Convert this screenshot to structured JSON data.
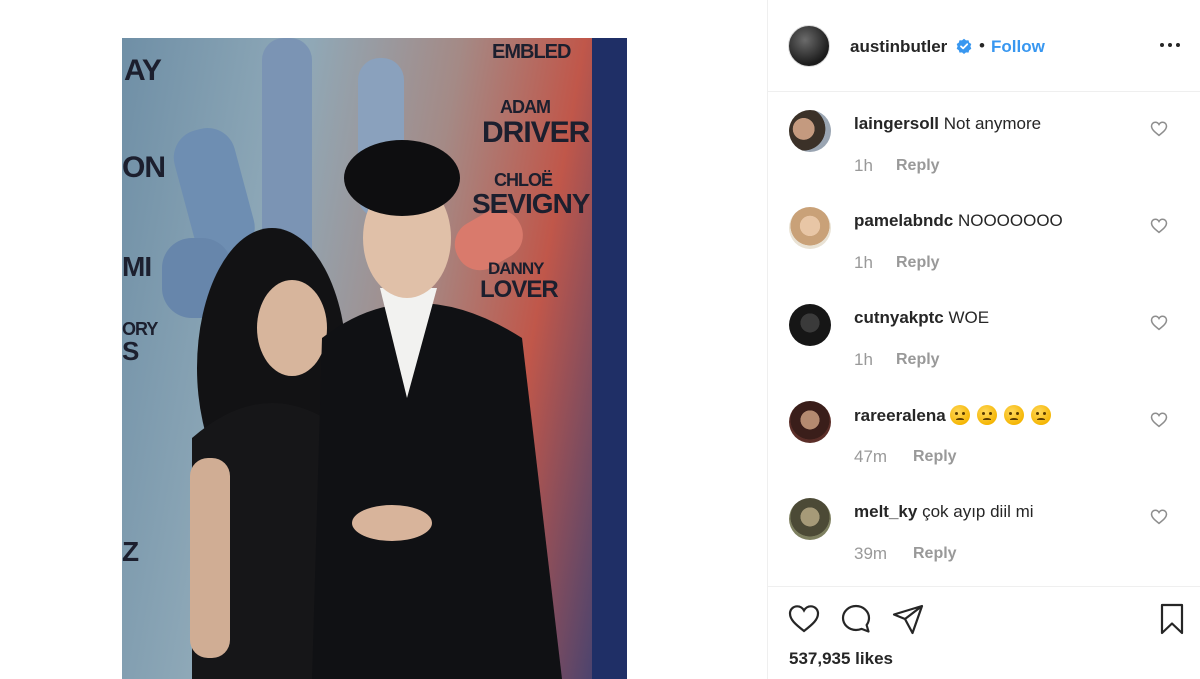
{
  "post": {
    "username": "austinbutler",
    "separator": "•",
    "follow_label": "Follow",
    "likes": "537,935 likes"
  },
  "poster": {
    "lines": [
      "EMBLED",
      "ADAM",
      "DRIVER",
      "CHLOË",
      "SEVIGNY",
      "DANNY",
      "LOVER",
      "AY",
      "ON",
      "MI",
      "ORY",
      "S",
      "Z"
    ]
  },
  "comments": [
    {
      "user": "laingersoll",
      "text": "Not anymore",
      "time": "1h",
      "reply": "Reply"
    },
    {
      "user": "pamelabndc",
      "text": "NOOOOOOO",
      "time": "1h",
      "reply": "Reply"
    },
    {
      "user": "cutnyakptc",
      "text": "WOE",
      "time": "1h",
      "reply": "Reply"
    },
    {
      "user": "rareeralena",
      "text": "",
      "emoji_count": 4,
      "time": "47m",
      "reply": "Reply"
    },
    {
      "user": "melt_ky",
      "text": "çok ayıp diil mi",
      "time": "39m",
      "reply": "Reply"
    }
  ],
  "colors": {
    "link_blue": "#3897f0",
    "text_dark": "#262626",
    "text_muted": "#999999",
    "border": "#efefef"
  },
  "icons": [
    "verified-badge-icon",
    "more-options-icon",
    "heart-icon",
    "comment-icon",
    "share-icon",
    "bookmark-icon"
  ]
}
